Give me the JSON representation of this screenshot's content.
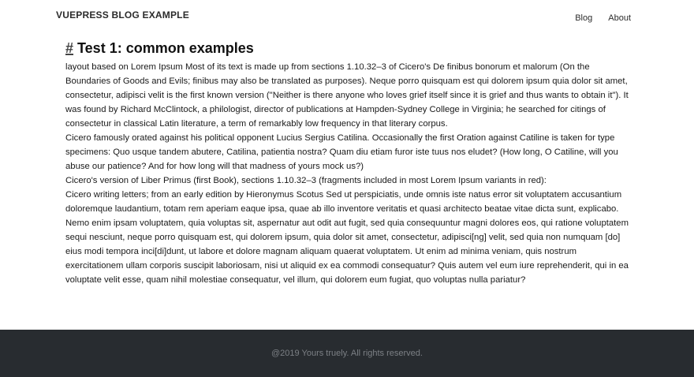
{
  "header": {
    "site_title": "VUEPRESS BLOG EXAMPLE",
    "nav": [
      {
        "label": "Blog"
      },
      {
        "label": "About"
      }
    ]
  },
  "article": {
    "anchor": "#",
    "title": "Test 1: common examples",
    "paragraphs": [
      "layout based on Lorem Ipsum Most of its text is made up from sections 1.10.32–3 of Cicero's De finibus bonorum et malorum (On the Boundaries of Goods and Evils; finibus may also be translated as purposes). Neque porro quisquam est qui dolorem ipsum quia dolor sit amet, consectetur, adipisci velit is the first known version (\"Neither is there anyone who loves grief itself since it is grief and thus wants to obtain it\"). It was found by Richard McClintock, a philologist, director of publications at Hampden-Sydney College in Virginia; he searched for citings of consectetur in classical Latin literature, a term of remarkably low frequency in that literary corpus.",
      "Cicero famously orated against his political opponent Lucius Sergius Catilina. Occasionally the first Oration against Catiline is taken for type specimens: Quo usque tandem abutere, Catilina, patientia nostra? Quam diu etiam furor iste tuus nos eludet? (How long, O Catiline, will you abuse our patience? And for how long will that madness of yours mock us?)",
      "Cicero's version of Liber Primus (first Book), sections 1.10.32–3 (fragments included in most Lorem Ipsum variants in red):",
      "Cicero writing letters; from an early edition by Hieronymus Scotus Sed ut perspiciatis, unde omnis iste natus error sit voluptatem accusantium doloremque laudantium, totam rem aperiam eaque ipsa, quae ab illo inventore veritatis et quasi architecto beatae vitae dicta sunt, explicabo. Nemo enim ipsam voluptatem, quia voluptas sit, aspernatur aut odit aut fugit, sed quia consequuntur magni dolores eos, qui ratione voluptatem sequi nesciunt, neque porro quisquam est, qui dolorem ipsum, quia dolor sit amet, consectetur, adipisci[ng] velit, sed quia non numquam [do] eius modi tempora inci[di]dunt, ut labore et dolore magnam aliquam quaerat voluptatem. Ut enim ad minima veniam, quis nostrum exercitationem ullam corporis suscipit laboriosam, nisi ut aliquid ex ea commodi consequatur? Quis autem vel eum iure reprehenderit, qui in ea voluptate velit esse, quam nihil molestiae consequatur, vel illum, qui dolorem eum fugiat, quo voluptas nulla pariatur?"
    ]
  },
  "footer": {
    "text": "@2019 Yours truely. All rights reserved."
  },
  "colors": {
    "footer_background": "#282c30",
    "footer_text": "#7c8085",
    "body_text": "#1a1a1a"
  }
}
